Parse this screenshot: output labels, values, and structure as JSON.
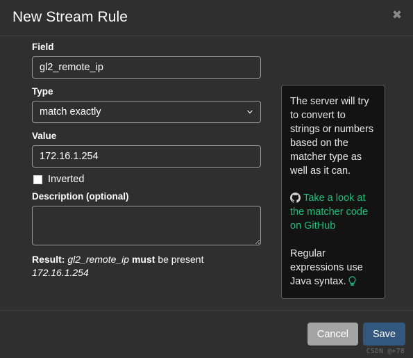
{
  "dialog": {
    "title": "New Stream Rule",
    "close_icon": "close-icon"
  },
  "form": {
    "field": {
      "label": "Field",
      "value": "gl2_remote_ip",
      "placeholder": ""
    },
    "type": {
      "label": "Type",
      "selected": "match exactly",
      "chevron_icon": "chevron-down-icon"
    },
    "value": {
      "label": "Value",
      "value": "172.16.1.254",
      "placeholder": ""
    },
    "inverted": {
      "label": "Inverted",
      "checked": false
    },
    "description": {
      "label": "Description (optional)",
      "value": "",
      "placeholder": ""
    },
    "result": {
      "prefix": "Result:",
      "field": "gl2_remote_ip",
      "modal": "must",
      "middle": "be present",
      "value": "172.16.1.254"
    }
  },
  "help": {
    "paragraph": "The server will try to convert to strings or numbers based on the matcher type as well as it can.",
    "link_text": "Take a look at the matcher code on GitHub",
    "link_icon": "github-icon",
    "note": "Regular expressions use Java syntax.",
    "note_icon": "lightbulb-icon",
    "link_color": "#1fbf7a"
  },
  "footer": {
    "cancel_label": "Cancel",
    "save_label": "Save",
    "save_color": "#33587f",
    "cancel_color": "#a4a4a4",
    "watermark": "CSDN @+78"
  }
}
